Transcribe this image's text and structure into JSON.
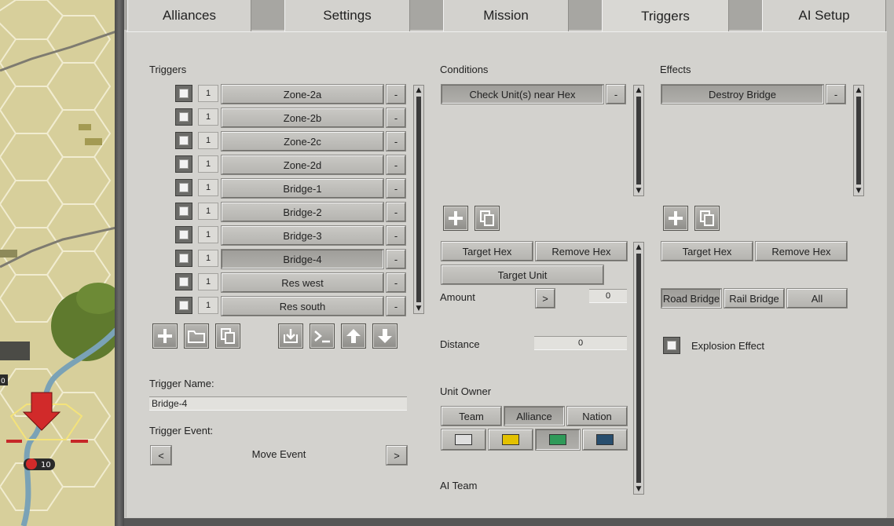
{
  "tabs": [
    {
      "label": "Alliances",
      "active": false
    },
    {
      "label": "Settings",
      "active": false
    },
    {
      "label": "Mission",
      "active": false
    },
    {
      "label": "Triggers",
      "active": true
    },
    {
      "label": "AI Setup",
      "active": false
    }
  ],
  "triggers": {
    "heading": "Triggers",
    "items": [
      {
        "count": "1",
        "name": "Zone-2a"
      },
      {
        "count": "1",
        "name": "Zone-2b"
      },
      {
        "count": "1",
        "name": "Zone-2c"
      },
      {
        "count": "1",
        "name": "Zone-2d"
      },
      {
        "count": "1",
        "name": "Bridge-1"
      },
      {
        "count": "1",
        "name": "Bridge-2"
      },
      {
        "count": "1",
        "name": "Bridge-3"
      },
      {
        "count": "1",
        "name": "Bridge-4"
      },
      {
        "count": "1",
        "name": "Res west"
      },
      {
        "count": "1",
        "name": "Res south"
      }
    ],
    "selected_index": 7,
    "remove_label": "-",
    "name_label": "Trigger Name:",
    "name_value": "Bridge-4",
    "event_label": "Trigger Event:",
    "event_value": "Move Event",
    "event_prev": "<",
    "event_next": ">"
  },
  "conditions": {
    "heading": "Conditions",
    "items": [
      {
        "name": "Check Unit(s) near Hex"
      }
    ],
    "remove_label": "-",
    "target_hex": "Target Hex",
    "remove_hex": "Remove Hex",
    "target_unit": "Target Unit",
    "amount_label": "Amount",
    "amount_btn": ">",
    "amount_value": "0",
    "distance_label": "Distance",
    "distance_value": "0",
    "owner_label": "Unit Owner",
    "owner_options": [
      {
        "label": "Team",
        "selected": false
      },
      {
        "label": "Alliance",
        "selected": true
      },
      {
        "label": "Nation",
        "selected": false
      }
    ],
    "colors": [
      {
        "hex": "#dedede",
        "selected": false
      },
      {
        "hex": "#e3c100",
        "selected": false
      },
      {
        "hex": "#2f9a59",
        "selected": true
      },
      {
        "hex": "#284e6e",
        "selected": false
      }
    ],
    "ai_team_label": "AI Team"
  },
  "effects": {
    "heading": "Effects",
    "items": [
      {
        "name": "Destroy Bridge"
      }
    ],
    "remove_label": "-",
    "target_hex": "Target Hex",
    "remove_hex": "Remove Hex",
    "bridge_options": [
      {
        "label": "Road Bridge",
        "selected": true
      },
      {
        "label": "Rail Bridge",
        "selected": false
      },
      {
        "label": "All",
        "selected": false
      }
    ],
    "explosion_label": "Explosion Effect"
  },
  "map": {
    "badge_value": "10",
    "left_badge": "0"
  }
}
